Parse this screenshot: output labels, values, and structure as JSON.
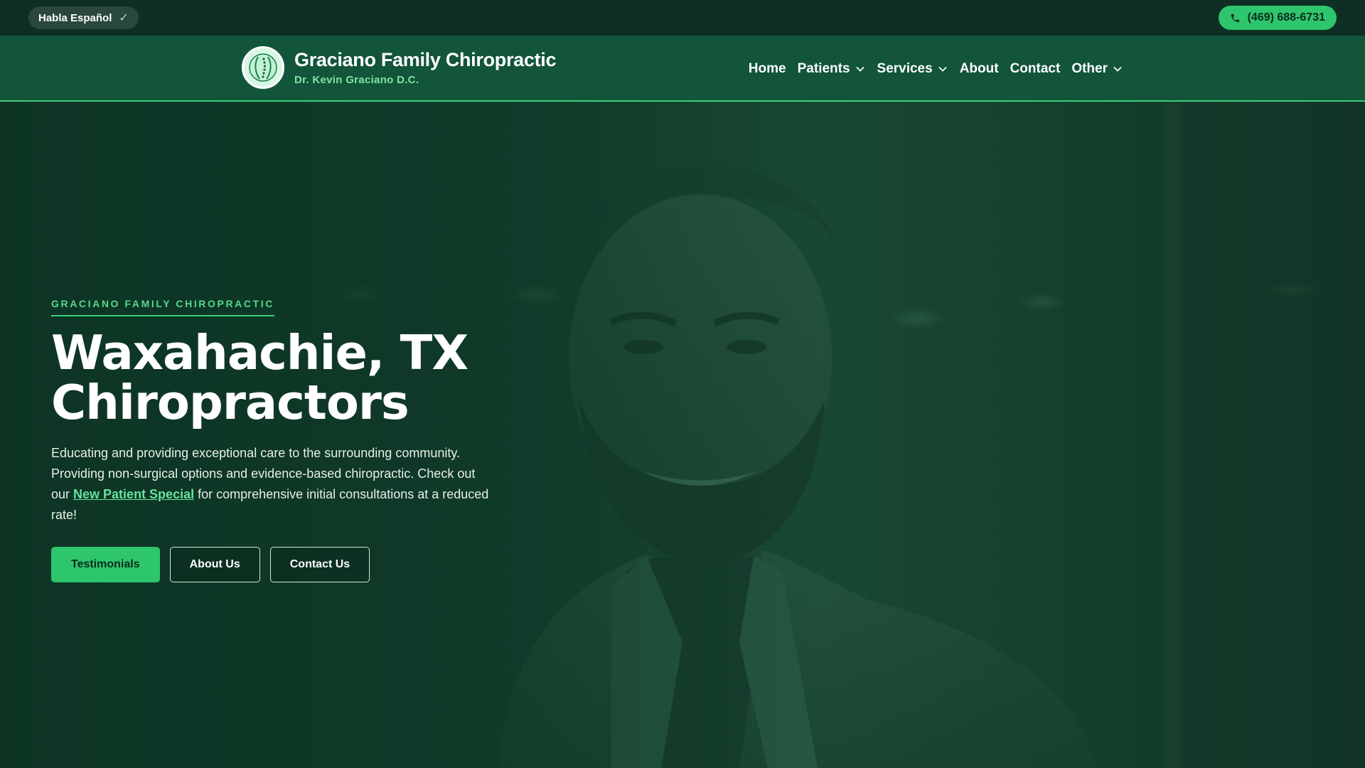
{
  "topbar": {
    "language_label": "Habla Español",
    "phone": "(469) 688-6731"
  },
  "brand": {
    "name": "Graciano Family Chiropractic",
    "doctor": "Dr. Kevin Graciano D.C."
  },
  "nav": {
    "items": [
      {
        "label": "Home",
        "has_dropdown": false
      },
      {
        "label": "Patients",
        "has_dropdown": true
      },
      {
        "label": "Services",
        "has_dropdown": true
      },
      {
        "label": "About",
        "has_dropdown": false
      },
      {
        "label": "Contact",
        "has_dropdown": false
      },
      {
        "label": "Other",
        "has_dropdown": true
      }
    ]
  },
  "hero": {
    "eyebrow": "GRACIANO FAMILY CHIROPRACTIC",
    "headline_line1": "Waxahachie, TX",
    "headline_line2": "Chiropractors",
    "intro_before": "Educating and providing exceptional care to the surrounding community. Providing non-surgical options and evidence-based chiropractic. Check out our ",
    "intro_link": "New Patient Special",
    "intro_after": " for comprehensive initial consultations at a reduced rate!",
    "buttons": {
      "primary": "Testimonials",
      "secondary": "About Us",
      "tertiary": "Contact Us"
    }
  },
  "colors": {
    "accent": "#2ec66c",
    "accent_text": "#57d88e",
    "header_bg": "#12553a",
    "topbar_bg": "#0f2f24"
  },
  "icons": {
    "language_check": "check-icon",
    "phone": "phone-icon",
    "dropdown": "chevron-down-icon",
    "logo": "spine-logo-icon"
  }
}
